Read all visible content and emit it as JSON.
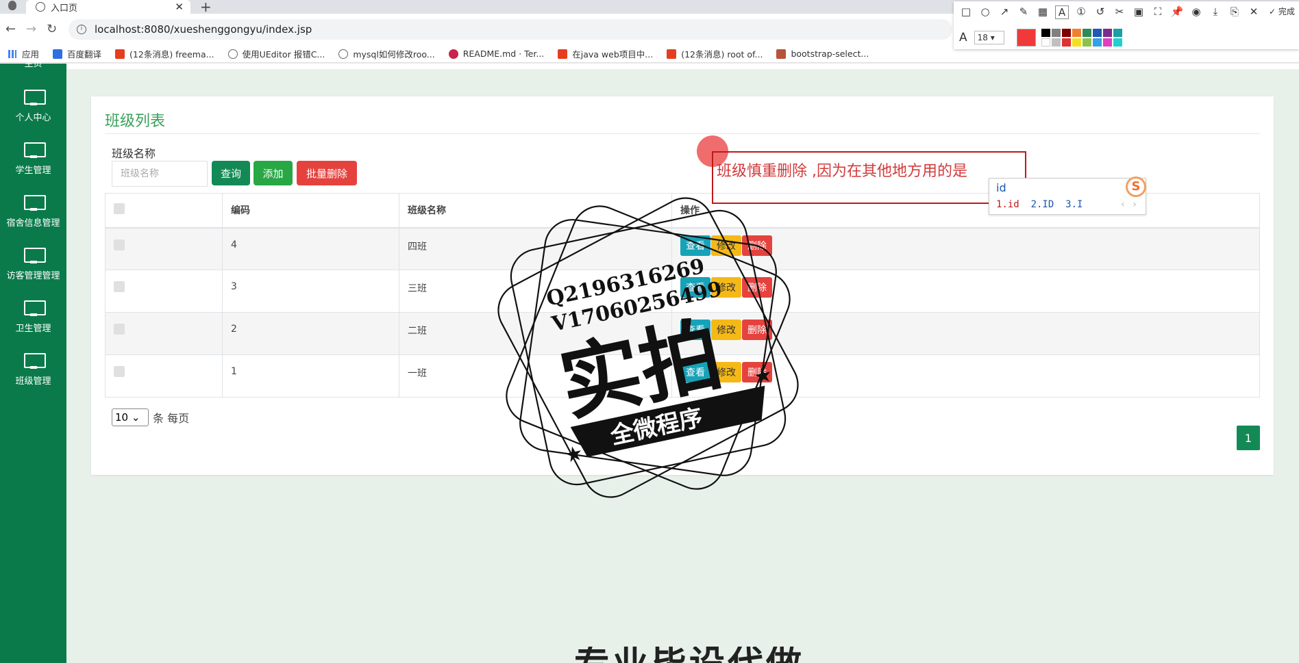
{
  "browser": {
    "tab_title": "入口页",
    "url": "localhost:8080/xueshenggongyu/index.jsp",
    "bookmarks": [
      {
        "label": "应用",
        "color": "#4285f4"
      },
      {
        "label": "百度翻译",
        "color": "#2f6fe0"
      },
      {
        "label": "(12条消息) freema...",
        "color": "#e53e1f"
      },
      {
        "label": "使用UEditor 报错C...",
        "color": "#666666"
      },
      {
        "label": "mysql如何修改roo...",
        "color": "#666666"
      },
      {
        "label": "README.md · Ter...",
        "color": "#c7254e"
      },
      {
        "label": "在java web项目中...",
        "color": "#e53e1f"
      },
      {
        "label": "(12条消息) root of...",
        "color": "#e53e1f"
      },
      {
        "label": "bootstrap-select...",
        "color": "#b5543a"
      }
    ]
  },
  "annotation_toolbar": {
    "finish_label": "完成",
    "font_size": "18",
    "current_color": "#f03a3a",
    "palette": [
      "#000000",
      "#808080",
      "#800000",
      "#f08030",
      "#2e8b57",
      "#1e5ab4",
      "#7a2d8f",
      "#1aa0a0",
      "#ffffff",
      "#c0c0c0",
      "#e03030",
      "#f5e020",
      "#8bc34a",
      "#35a0e8",
      "#e040c0",
      "#20d0d0"
    ]
  },
  "sidebar": {
    "top_label": "主页",
    "items": [
      {
        "label": "个人中心"
      },
      {
        "label": "学生管理"
      },
      {
        "label": "宿舍信息管理"
      },
      {
        "label": "访客管理管理"
      },
      {
        "label": "卫生管理"
      },
      {
        "label": "班级管理"
      }
    ]
  },
  "page": {
    "title": "班级列表",
    "filter_label": "班级名称",
    "filter_placeholder": "班级名称",
    "buttons": {
      "query": "查询",
      "add": "添加",
      "batch_delete": "批量删除"
    },
    "table": {
      "headers": [
        "编码",
        "班级名称",
        "操作"
      ],
      "rows": [
        {
          "code": "4",
          "name": "四班"
        },
        {
          "code": "3",
          "name": "三班"
        },
        {
          "code": "2",
          "name": "二班"
        },
        {
          "code": "1",
          "name": "一班"
        }
      ],
      "ops": {
        "view": "查看",
        "edit": "修改",
        "delete": "删除"
      }
    },
    "pager": {
      "page_size": "10",
      "suffix": "条 每页",
      "current_page": "1"
    },
    "bottom_text": "专业毕设代做"
  },
  "overlay": {
    "note_text": "班级慎重删除 ,因为在其他地方用的是",
    "ime_input": "id",
    "ime_candidates": [
      "1.id",
      "2.ID",
      "3.I"
    ]
  },
  "watermark": {
    "line1": "Q2196316269",
    "line2": "V17060256499",
    "big": "实拍",
    "ribbon": "全微程序"
  }
}
